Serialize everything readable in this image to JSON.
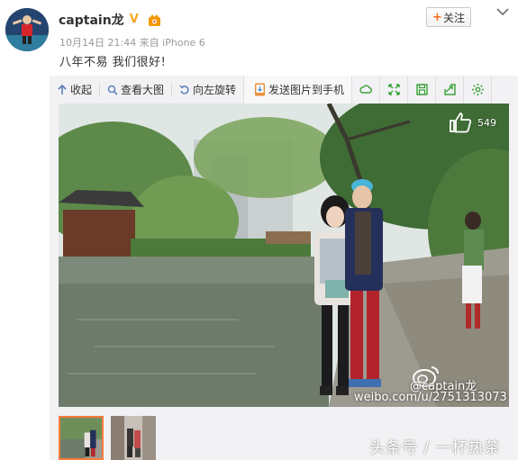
{
  "user": {
    "name": "captain龙",
    "verified_badge": "V",
    "vip_icon": "vip-icon"
  },
  "follow_button": {
    "label": "关注",
    "plus": "+"
  },
  "post": {
    "meta": "10月14日 21:44 来自 iPhone 6",
    "text": "八年不易 我们很好!"
  },
  "toolbar": {
    "collapse": "收起",
    "view_large": "查看大图",
    "rotate_left": "向左旋转",
    "send_to_phone": "发送图片到手机",
    "icons": [
      "cloud-icon",
      "fullscreen-icon",
      "save-icon",
      "share-icon",
      "settings-icon"
    ]
  },
  "photo": {
    "like_count": "549",
    "watermark_handle": "@captain龙",
    "watermark_url": "weibo.com/u/2751313073"
  },
  "footer": {
    "source_watermark": "头条号 / 一杯热茶"
  },
  "colors": {
    "accent": "#fa7d3c",
    "toolbar_icon": "#3aa136",
    "link": "#333333"
  }
}
